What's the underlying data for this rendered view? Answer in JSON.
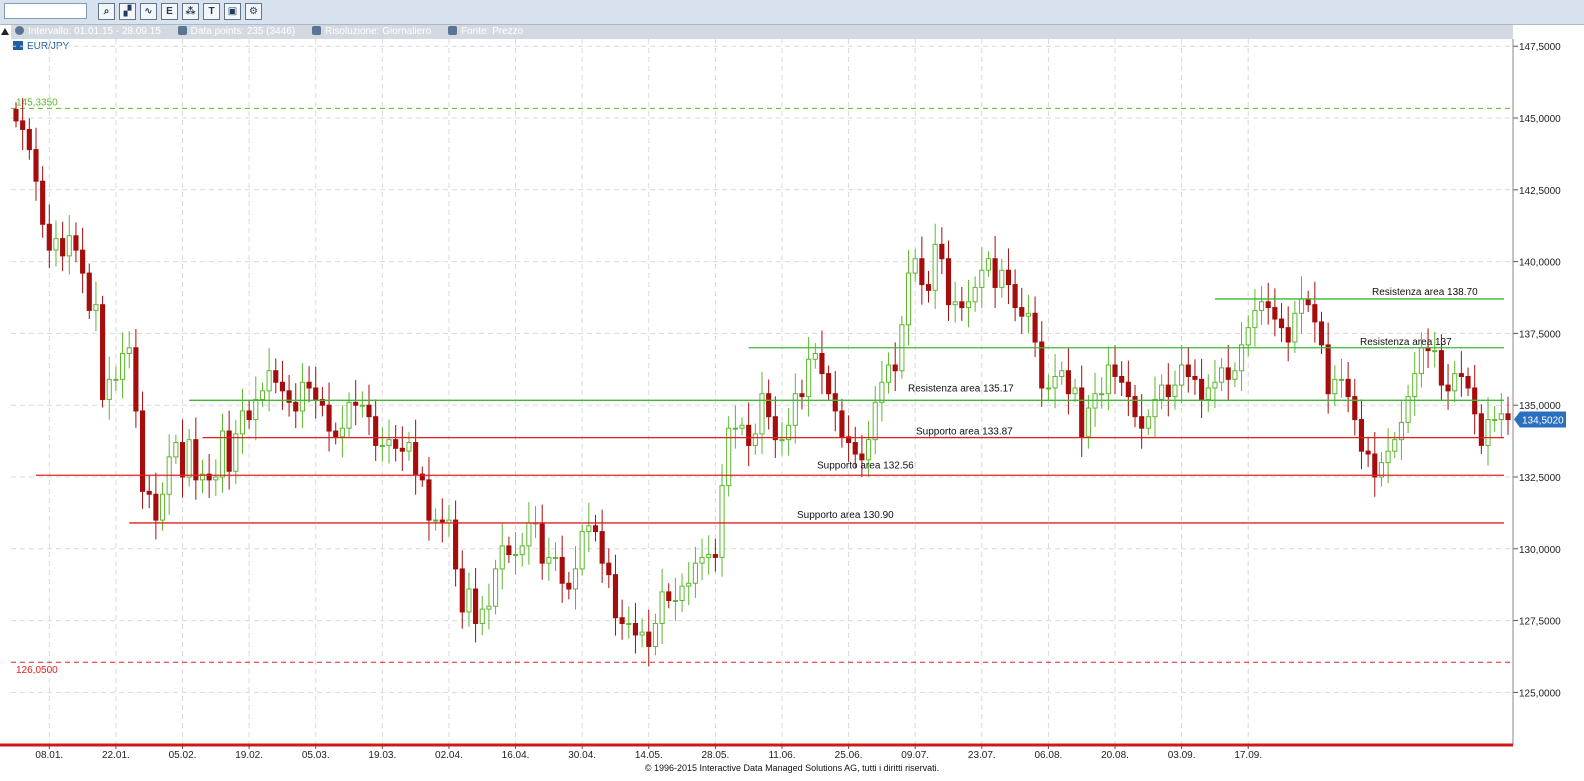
{
  "toolbar": {
    "icons": [
      "zoom-icon",
      "chart-type-icon",
      "line-chart-icon",
      "indicator-icon",
      "compare-icon",
      "text-tool-icon",
      "save-icon",
      "settings-icon"
    ]
  },
  "infobar": {
    "interval_label": "Intervallo:",
    "interval_value": "01.01.15 - 28.09.15",
    "datapoints_label": "Data points:",
    "datapoints_value": "235 (3446)",
    "resolution_label": "Risoluzione:",
    "resolution_value": "Giornaliero",
    "source_label": "Fonte:",
    "source_value": "Prezzo"
  },
  "symbol": "EUR/JPY",
  "footer": "© 1996-2015 Interactive Data Managed Solutions AG, tutti i diritti riservati.",
  "colors": {
    "up": "#5cb82e",
    "down": "#a60d0d",
    "support": "#e02020",
    "resistance": "#3cb832",
    "grid": "#d9d9d9",
    "current": "#2a6fc0"
  },
  "chart_data": {
    "type": "candlestick",
    "title": "EUR/JPY",
    "ylim": [
      123.0,
      148.3
    ],
    "yticks": [
      "147,5000",
      "145,0000",
      "142,5000",
      "140,0000",
      "137,5000",
      "135,0000",
      "132,5000",
      "130,0000",
      "127,5000",
      "125,0000"
    ],
    "ytick_values": [
      147.5,
      145.0,
      142.5,
      140.0,
      137.5,
      135.0,
      132.5,
      130.0,
      127.5,
      125.0
    ],
    "xticks": [
      "08.01.",
      "22.01.",
      "05.02.",
      "19.02.",
      "05.03.",
      "19.03.",
      "02.04.",
      "16.04.",
      "30.04.",
      "14.05.",
      "28.05.",
      "11.06.",
      "25.06.",
      "09.07.",
      "23.07.",
      "06.08.",
      "20.08.",
      "03.09.",
      "17.09."
    ],
    "period_high": {
      "label": "145,3350",
      "value": 145.335
    },
    "period_low": {
      "label": "126,0500",
      "value": 126.05
    },
    "last_price": {
      "label": "134,5020",
      "value": 134.502
    },
    "levels": [
      {
        "label": "Resistenza area 138.70",
        "value": 138.7,
        "kind": "resistance",
        "from": "06.08.",
        "to": "28.09."
      },
      {
        "label": "Resistenza area 137",
        "value": 137.0,
        "kind": "resistance",
        "from": "14.05.",
        "to": "28.09."
      },
      {
        "label": "Resistenza area 135.17",
        "value": 135.17,
        "kind": "resistance",
        "from": "02.02.",
        "to": "28.09."
      },
      {
        "label": "Supporto area 133.87",
        "value": 133.87,
        "kind": "support",
        "from": "05.02.",
        "to": "28.09."
      },
      {
        "label": "Supporto area 132.56",
        "value": 132.56,
        "kind": "support",
        "from": "05.01.",
        "to": "28.09."
      },
      {
        "label": "Supporto area 130.90",
        "value": 130.9,
        "kind": "support",
        "from": "22.01.",
        "to": "28.09."
      }
    ],
    "closes": [
      144.9,
      144.6,
      143.9,
      142.8,
      141.3,
      140.4,
      140.8,
      140.2,
      140.9,
      140.4,
      139.6,
      138.3,
      138.5,
      135.2,
      135.9,
      135.9,
      136.8,
      137.0,
      134.8,
      132.0,
      131.9,
      131.0,
      131.9,
      133.2,
      133.7,
      132.5,
      133.8,
      132.4,
      132.6,
      132.4,
      132.5,
      134.1,
      132.7,
      134.0,
      134.8,
      134.5,
      135.2,
      135.5,
      136.2,
      135.8,
      135.5,
      135.1,
      134.8,
      135.8,
      135.6,
      135.2,
      135.0,
      134.1,
      133.9,
      134.2,
      135.1,
      135.0,
      135.0,
      134.6,
      133.6,
      133.6,
      133.8,
      133.5,
      133.4,
      133.7,
      132.6,
      132.4,
      131.0,
      131.0,
      130.9,
      131.0,
      129.3,
      127.8,
      128.6,
      127.4,
      127.9,
      128.0,
      129.3,
      130.1,
      129.8,
      129.8,
      130.1,
      130.9,
      130.9,
      129.5,
      129.7,
      129.7,
      128.8,
      128.6,
      129.3,
      130.6,
      130.8,
      130.6,
      129.5,
      129.1,
      127.6,
      127.4,
      127.4,
      127.0,
      127.1,
      126.6,
      127.4,
      128.5,
      128.2,
      128.2,
      128.7,
      128.8,
      129.5,
      129.7,
      129.8,
      129.7,
      132.2,
      134.2,
      134.2,
      134.3,
      133.6,
      134.0,
      135.4,
      134.6,
      133.8,
      133.8,
      134.3,
      135.4,
      135.3,
      136.6,
      136.8,
      136.1,
      135.4,
      134.8,
      133.9,
      133.7,
      133.3,
      133.1,
      133.8,
      135.1,
      135.8,
      136.4,
      136.2,
      137.8,
      139.6,
      140.1,
      139.2,
      139.0,
      140.6,
      140.1,
      138.5,
      138.6,
      138.4,
      138.6,
      139.1,
      139.7,
      140.1,
      139.1,
      139.7,
      139.2,
      138.4,
      138.1,
      138.2,
      137.2,
      135.6,
      135.6,
      136.0,
      136.2,
      135.4,
      135.6,
      133.9,
      134.9,
      135.4,
      135.4,
      136.4,
      136.0,
      135.8,
      135.3,
      134.6,
      134.2,
      134.6,
      135.2,
      135.7,
      135.3,
      135.7,
      136.4,
      136.0,
      135.9,
      135.2,
      135.6,
      135.8,
      136.3,
      135.9,
      136.2,
      137.1,
      137.7,
      138.3,
      138.6,
      138.4,
      138.0,
      137.7,
      137.2,
      138.2,
      138.7,
      138.5,
      137.9,
      137.1,
      135.4,
      135.9,
      135.9,
      135.3,
      134.5,
      133.4,
      133.3,
      132.5,
      133.0,
      133.4,
      133.8,
      134.4,
      135.3,
      136.1,
      137.0,
      136.9,
      136.9,
      135.7,
      135.5,
      136.1,
      136.0,
      135.6,
      134.7,
      133.6,
      134.5,
      134.5,
      134.7,
      134.5
    ]
  }
}
